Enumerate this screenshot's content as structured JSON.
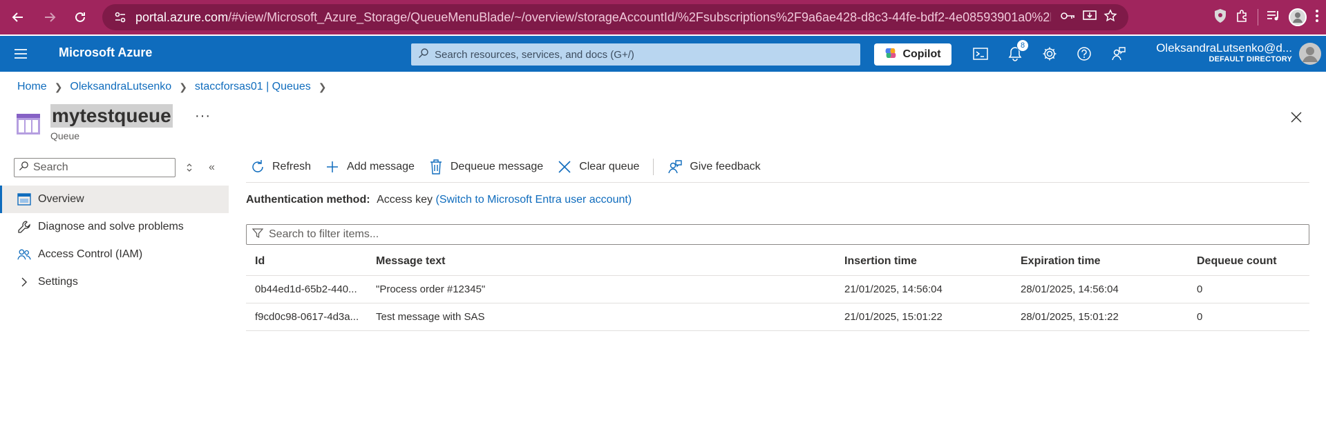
{
  "browser": {
    "url_host": "portal.azure.com",
    "url_rest": "/#view/Microsoft_Azure_Storage/QueueMenuBlade/~/overview/storageAccountId/%2Fsubscriptions%2F9a6ae428-d8c3-44fe-bdf2-4e08593901a0%2Fres..."
  },
  "header": {
    "brand": "Microsoft Azure",
    "search_placeholder": "Search resources, services, and docs (G+/)",
    "copilot_label": "Copilot",
    "notification_count": "8",
    "account_name": "OleksandraLutsenko@d...",
    "account_directory": "DEFAULT DIRECTORY"
  },
  "breadcrumb": [
    "Home",
    "OleksandraLutsenko",
    "staccforsas01 | Queues"
  ],
  "blade": {
    "title": "mytestqueue",
    "subtitle": "Queue",
    "more": "···"
  },
  "nav": {
    "search_placeholder": "Search",
    "items": [
      {
        "label": "Overview",
        "icon": "queue-overview-icon",
        "active": true
      },
      {
        "label": "Diagnose and solve problems",
        "icon": "wrench-icon"
      },
      {
        "label": "Access Control (IAM)",
        "icon": "people-icon"
      },
      {
        "label": "Settings",
        "icon": "chevron-right-icon"
      }
    ]
  },
  "toolbar": {
    "refresh": "Refresh",
    "add_message": "Add message",
    "dequeue_message": "Dequeue message",
    "clear_queue": "Clear queue",
    "give_feedback": "Give feedback"
  },
  "auth": {
    "label": "Authentication method:",
    "value": "Access key",
    "switch_link": "(Switch to Microsoft Entra user account)"
  },
  "filter": {
    "placeholder": "Search to filter items..."
  },
  "table": {
    "columns": [
      "Id",
      "Message text",
      "Insertion time",
      "Expiration time",
      "Dequeue count"
    ],
    "rows": [
      [
        "0b44ed1d-65b2-440...",
        "\"Process order #12345\"",
        "21/01/2025, 14:56:04",
        "28/01/2025, 14:56:04",
        "0"
      ],
      [
        "f9cd0c98-0617-4d3a...",
        "Test message with SAS",
        "21/01/2025, 15:01:22",
        "28/01/2025, 15:01:22",
        "0"
      ]
    ]
  },
  "colors": {
    "chrome": "#a0255d",
    "azure_header": "#0f6cbd",
    "link": "#0f6cbd"
  }
}
